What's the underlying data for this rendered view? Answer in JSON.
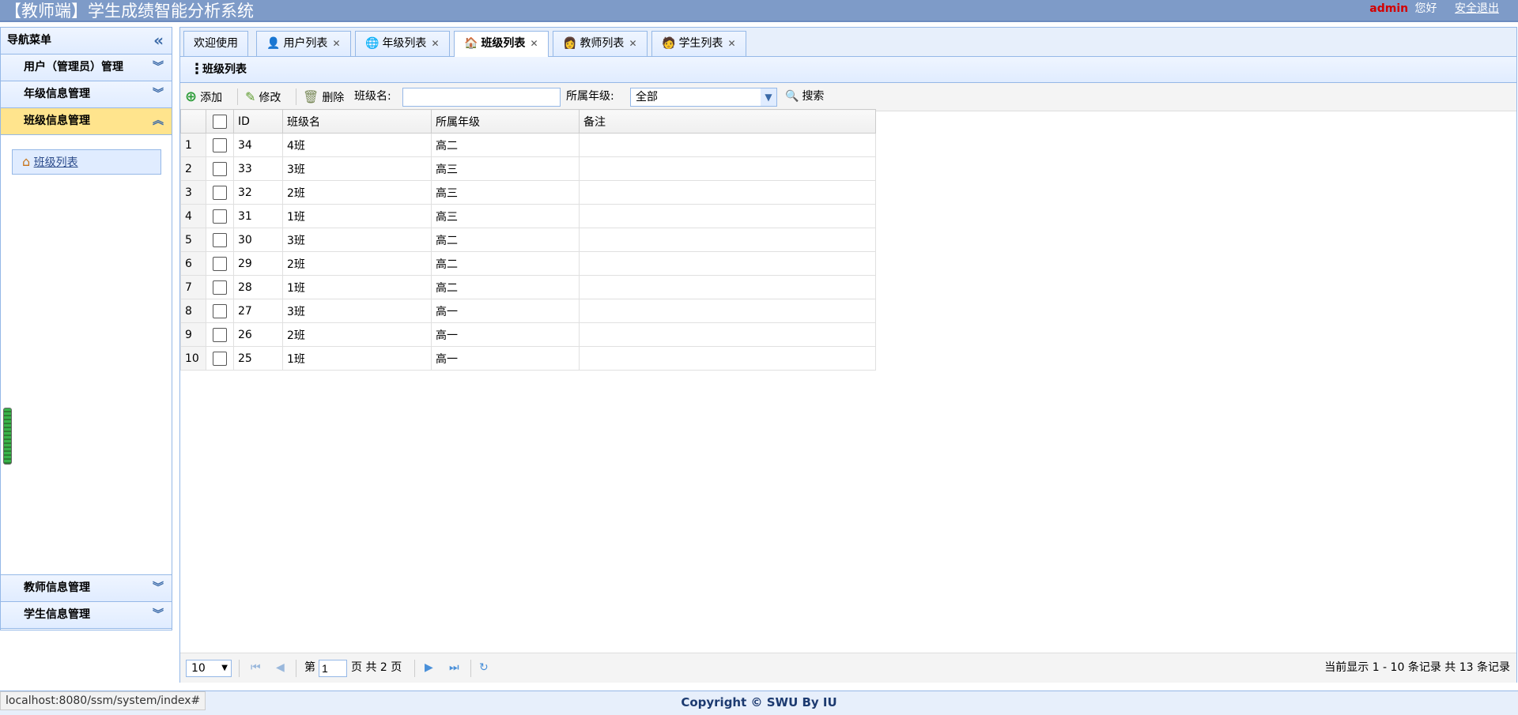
{
  "header": {
    "title": "【教师端】学生成绩智能分析系统",
    "user": "admin",
    "greeting": "您好",
    "logout": "安全退出"
  },
  "sidebar": {
    "title": "导航菜单",
    "groups": [
      {
        "label": "用户（管理员）管理"
      },
      {
        "label": "年级信息管理"
      },
      {
        "label": "班级信息管理"
      }
    ],
    "active_item": "班级列表",
    "bottom_groups": [
      {
        "label": "教师信息管理"
      },
      {
        "label": "学生信息管理"
      }
    ]
  },
  "tabs": [
    {
      "label": "欢迎使用"
    },
    {
      "label": "用户列表"
    },
    {
      "label": "年级列表"
    },
    {
      "label": "班级列表"
    },
    {
      "label": "教师列表"
    },
    {
      "label": "学生列表"
    }
  ],
  "panel": {
    "title": "班级列表"
  },
  "toolbar": {
    "add": "添加",
    "edit": "修改",
    "delete": "删除",
    "class_name_label": "班级名:",
    "class_name_value": "",
    "grade_label": "所属年级:",
    "grade_value": "全部",
    "search": "搜索"
  },
  "table": {
    "headers": [
      "ID",
      "班级名",
      "所属年级",
      "备注"
    ],
    "rows": [
      {
        "n": "1",
        "id": "34",
        "name": "4班",
        "grade": "高二",
        "note": ""
      },
      {
        "n": "2",
        "id": "33",
        "name": "3班",
        "grade": "高三",
        "note": ""
      },
      {
        "n": "3",
        "id": "32",
        "name": "2班",
        "grade": "高三",
        "note": ""
      },
      {
        "n": "4",
        "id": "31",
        "name": "1班",
        "grade": "高三",
        "note": ""
      },
      {
        "n": "5",
        "id": "30",
        "name": "3班",
        "grade": "高二",
        "note": ""
      },
      {
        "n": "6",
        "id": "29",
        "name": "2班",
        "grade": "高二",
        "note": ""
      },
      {
        "n": "7",
        "id": "28",
        "name": "1班",
        "grade": "高二",
        "note": ""
      },
      {
        "n": "8",
        "id": "27",
        "name": "3班",
        "grade": "高一",
        "note": ""
      },
      {
        "n": "9",
        "id": "26",
        "name": "2班",
        "grade": "高一",
        "note": ""
      },
      {
        "n": "10",
        "id": "25",
        "name": "1班",
        "grade": "高一",
        "note": ""
      }
    ]
  },
  "pager": {
    "page_size": "10",
    "page_prefix": "第",
    "page_value": "1",
    "page_suffix": "页 共 2 页",
    "summary": "当前显示 1 - 10 条记录 共 13 条记录"
  },
  "footer": {
    "copyright": "Copyright © SWU By IU",
    "status_url": "localhost:8080/ssm/system/index#"
  },
  "colors": {
    "header_bg": "#7e9bc8",
    "border": "#95b8e7",
    "active_group": "#ffe48d",
    "user_name": "#d40000"
  }
}
